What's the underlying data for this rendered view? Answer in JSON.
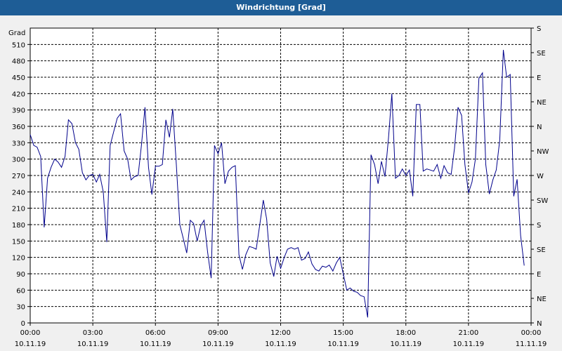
{
  "window": {
    "title": "Windrichtung [Grad]"
  },
  "chart_data": {
    "type": "line",
    "title": "Windrichtung [Grad]",
    "ylabel": "Grad",
    "xlabel": "",
    "ylim": [
      0,
      540
    ],
    "xlim_hours": [
      0,
      24
    ],
    "y_ticks": [
      0,
      30,
      60,
      90,
      120,
      150,
      180,
      210,
      240,
      270,
      300,
      330,
      360,
      390,
      420,
      450,
      480,
      510
    ],
    "right_axis_ticks": [
      {
        "value": 0,
        "label": "N"
      },
      {
        "value": 45,
        "label": "NE"
      },
      {
        "value": 90,
        "label": "E"
      },
      {
        "value": 135,
        "label": "SE"
      },
      {
        "value": 180,
        "label": "S"
      },
      {
        "value": 225,
        "label": "SW"
      },
      {
        "value": 270,
        "label": "W"
      },
      {
        "value": 315,
        "label": "NW"
      },
      {
        "value": 360,
        "label": "N"
      },
      {
        "value": 405,
        "label": "NE"
      },
      {
        "value": 450,
        "label": "E"
      },
      {
        "value": 495,
        "label": "SE"
      },
      {
        "value": 540,
        "label": "S"
      }
    ],
    "x_ticks": [
      {
        "hour": 0,
        "time": "00:00",
        "date": "10.11.19"
      },
      {
        "hour": 3,
        "time": "03:00",
        "date": "10.11.19"
      },
      {
        "hour": 6,
        "time": "06:00",
        "date": "10.11.19"
      },
      {
        "hour": 9,
        "time": "09:00",
        "date": "10.11.19"
      },
      {
        "hour": 12,
        "time": "12:00",
        "date": "10.11.19"
      },
      {
        "hour": 15,
        "time": "15:00",
        "date": "10.11.19"
      },
      {
        "hour": 18,
        "time": "18:00",
        "date": "10.11.19"
      },
      {
        "hour": 21,
        "time": "21:00",
        "date": "10.11.19"
      },
      {
        "hour": 24,
        "time": "00:00",
        "date": "11.11.19"
      }
    ],
    "grid": true,
    "series": [
      {
        "color": "#00008b",
        "points": [
          [
            0.0,
            345
          ],
          [
            0.17,
            325
          ],
          [
            0.33,
            322
          ],
          [
            0.5,
            305
          ],
          [
            0.67,
            175
          ],
          [
            0.83,
            265
          ],
          [
            1.0,
            285
          ],
          [
            1.17,
            300
          ],
          [
            1.33,
            295
          ],
          [
            1.5,
            285
          ],
          [
            1.67,
            305
          ],
          [
            1.83,
            372
          ],
          [
            2.0,
            365
          ],
          [
            2.17,
            330
          ],
          [
            2.33,
            318
          ],
          [
            2.5,
            275
          ],
          [
            2.67,
            262
          ],
          [
            2.83,
            270
          ],
          [
            3.0,
            272
          ],
          [
            3.17,
            258
          ],
          [
            3.33,
            272
          ],
          [
            3.5,
            240
          ],
          [
            3.67,
            148
          ],
          [
            3.83,
            325
          ],
          [
            4.0,
            350
          ],
          [
            4.17,
            375
          ],
          [
            4.33,
            383
          ],
          [
            4.5,
            315
          ],
          [
            4.67,
            300
          ],
          [
            4.83,
            262
          ],
          [
            5.0,
            268
          ],
          [
            5.17,
            270
          ],
          [
            5.33,
            325
          ],
          [
            5.5,
            395
          ],
          [
            5.67,
            285
          ],
          [
            5.83,
            235
          ],
          [
            6.0,
            287
          ],
          [
            6.17,
            287
          ],
          [
            6.33,
            290
          ],
          [
            6.5,
            372
          ],
          [
            6.67,
            340
          ],
          [
            6.83,
            392
          ],
          [
            7.0,
            290
          ],
          [
            7.17,
            180
          ],
          [
            7.33,
            155
          ],
          [
            7.5,
            128
          ],
          [
            7.67,
            188
          ],
          [
            7.83,
            182
          ],
          [
            8.0,
            150
          ],
          [
            8.17,
            178
          ],
          [
            8.33,
            188
          ],
          [
            8.5,
            130
          ],
          [
            8.67,
            82
          ],
          [
            8.83,
            325
          ],
          [
            9.0,
            310
          ],
          [
            9.17,
            330
          ],
          [
            9.33,
            255
          ],
          [
            9.5,
            278
          ],
          [
            9.67,
            285
          ],
          [
            9.83,
            288
          ],
          [
            10.0,
            125
          ],
          [
            10.17,
            98
          ],
          [
            10.33,
            125
          ],
          [
            10.5,
            140
          ],
          [
            10.67,
            138
          ],
          [
            10.83,
            135
          ],
          [
            11.0,
            180
          ],
          [
            11.17,
            225
          ],
          [
            11.33,
            190
          ],
          [
            11.5,
            110
          ],
          [
            11.67,
            85
          ],
          [
            11.83,
            122
          ],
          [
            12.0,
            100
          ],
          [
            12.17,
            120
          ],
          [
            12.33,
            135
          ],
          [
            12.5,
            138
          ],
          [
            12.67,
            135
          ],
          [
            12.83,
            138
          ],
          [
            13.0,
            115
          ],
          [
            13.17,
            118
          ],
          [
            13.33,
            130
          ],
          [
            13.5,
            108
          ],
          [
            13.67,
            98
          ],
          [
            13.83,
            95
          ],
          [
            14.0,
            104
          ],
          [
            14.17,
            102
          ],
          [
            14.33,
            106
          ],
          [
            14.5,
            95
          ],
          [
            14.67,
            110
          ],
          [
            14.83,
            120
          ],
          [
            15.0,
            90
          ],
          [
            15.17,
            60
          ],
          [
            15.33,
            64
          ],
          [
            15.5,
            58
          ],
          [
            15.67,
            56
          ],
          [
            15.83,
            50
          ],
          [
            16.0,
            48
          ],
          [
            16.17,
            10
          ],
          [
            16.33,
            308
          ],
          [
            16.5,
            290
          ],
          [
            16.67,
            255
          ],
          [
            16.83,
            296
          ],
          [
            17.0,
            268
          ],
          [
            17.17,
            340
          ],
          [
            17.33,
            420
          ],
          [
            17.5,
            265
          ],
          [
            17.67,
            270
          ],
          [
            17.83,
            282
          ],
          [
            18.0,
            270
          ],
          [
            18.17,
            280
          ],
          [
            18.33,
            232
          ],
          [
            18.5,
            400
          ],
          [
            18.67,
            400
          ],
          [
            18.83,
            278
          ],
          [
            19.0,
            282
          ],
          [
            19.17,
            280
          ],
          [
            19.33,
            278
          ],
          [
            19.5,
            290
          ],
          [
            19.67,
            265
          ],
          [
            19.83,
            288
          ],
          [
            20.0,
            275
          ],
          [
            20.17,
            272
          ],
          [
            20.33,
            320
          ],
          [
            20.5,
            395
          ],
          [
            20.67,
            380
          ],
          [
            20.83,
            290
          ],
          [
            21.0,
            238
          ],
          [
            21.17,
            258
          ],
          [
            21.33,
            300
          ],
          [
            21.5,
            448
          ],
          [
            21.67,
            458
          ],
          [
            21.83,
            290
          ],
          [
            22.0,
            236
          ],
          [
            22.17,
            262
          ],
          [
            22.33,
            280
          ],
          [
            22.5,
            335
          ],
          [
            22.67,
            500
          ],
          [
            22.83,
            450
          ],
          [
            23.0,
            455
          ],
          [
            23.17,
            232
          ],
          [
            23.33,
            263
          ],
          [
            23.5,
            160
          ],
          [
            23.67,
            105
          ]
        ]
      }
    ]
  }
}
